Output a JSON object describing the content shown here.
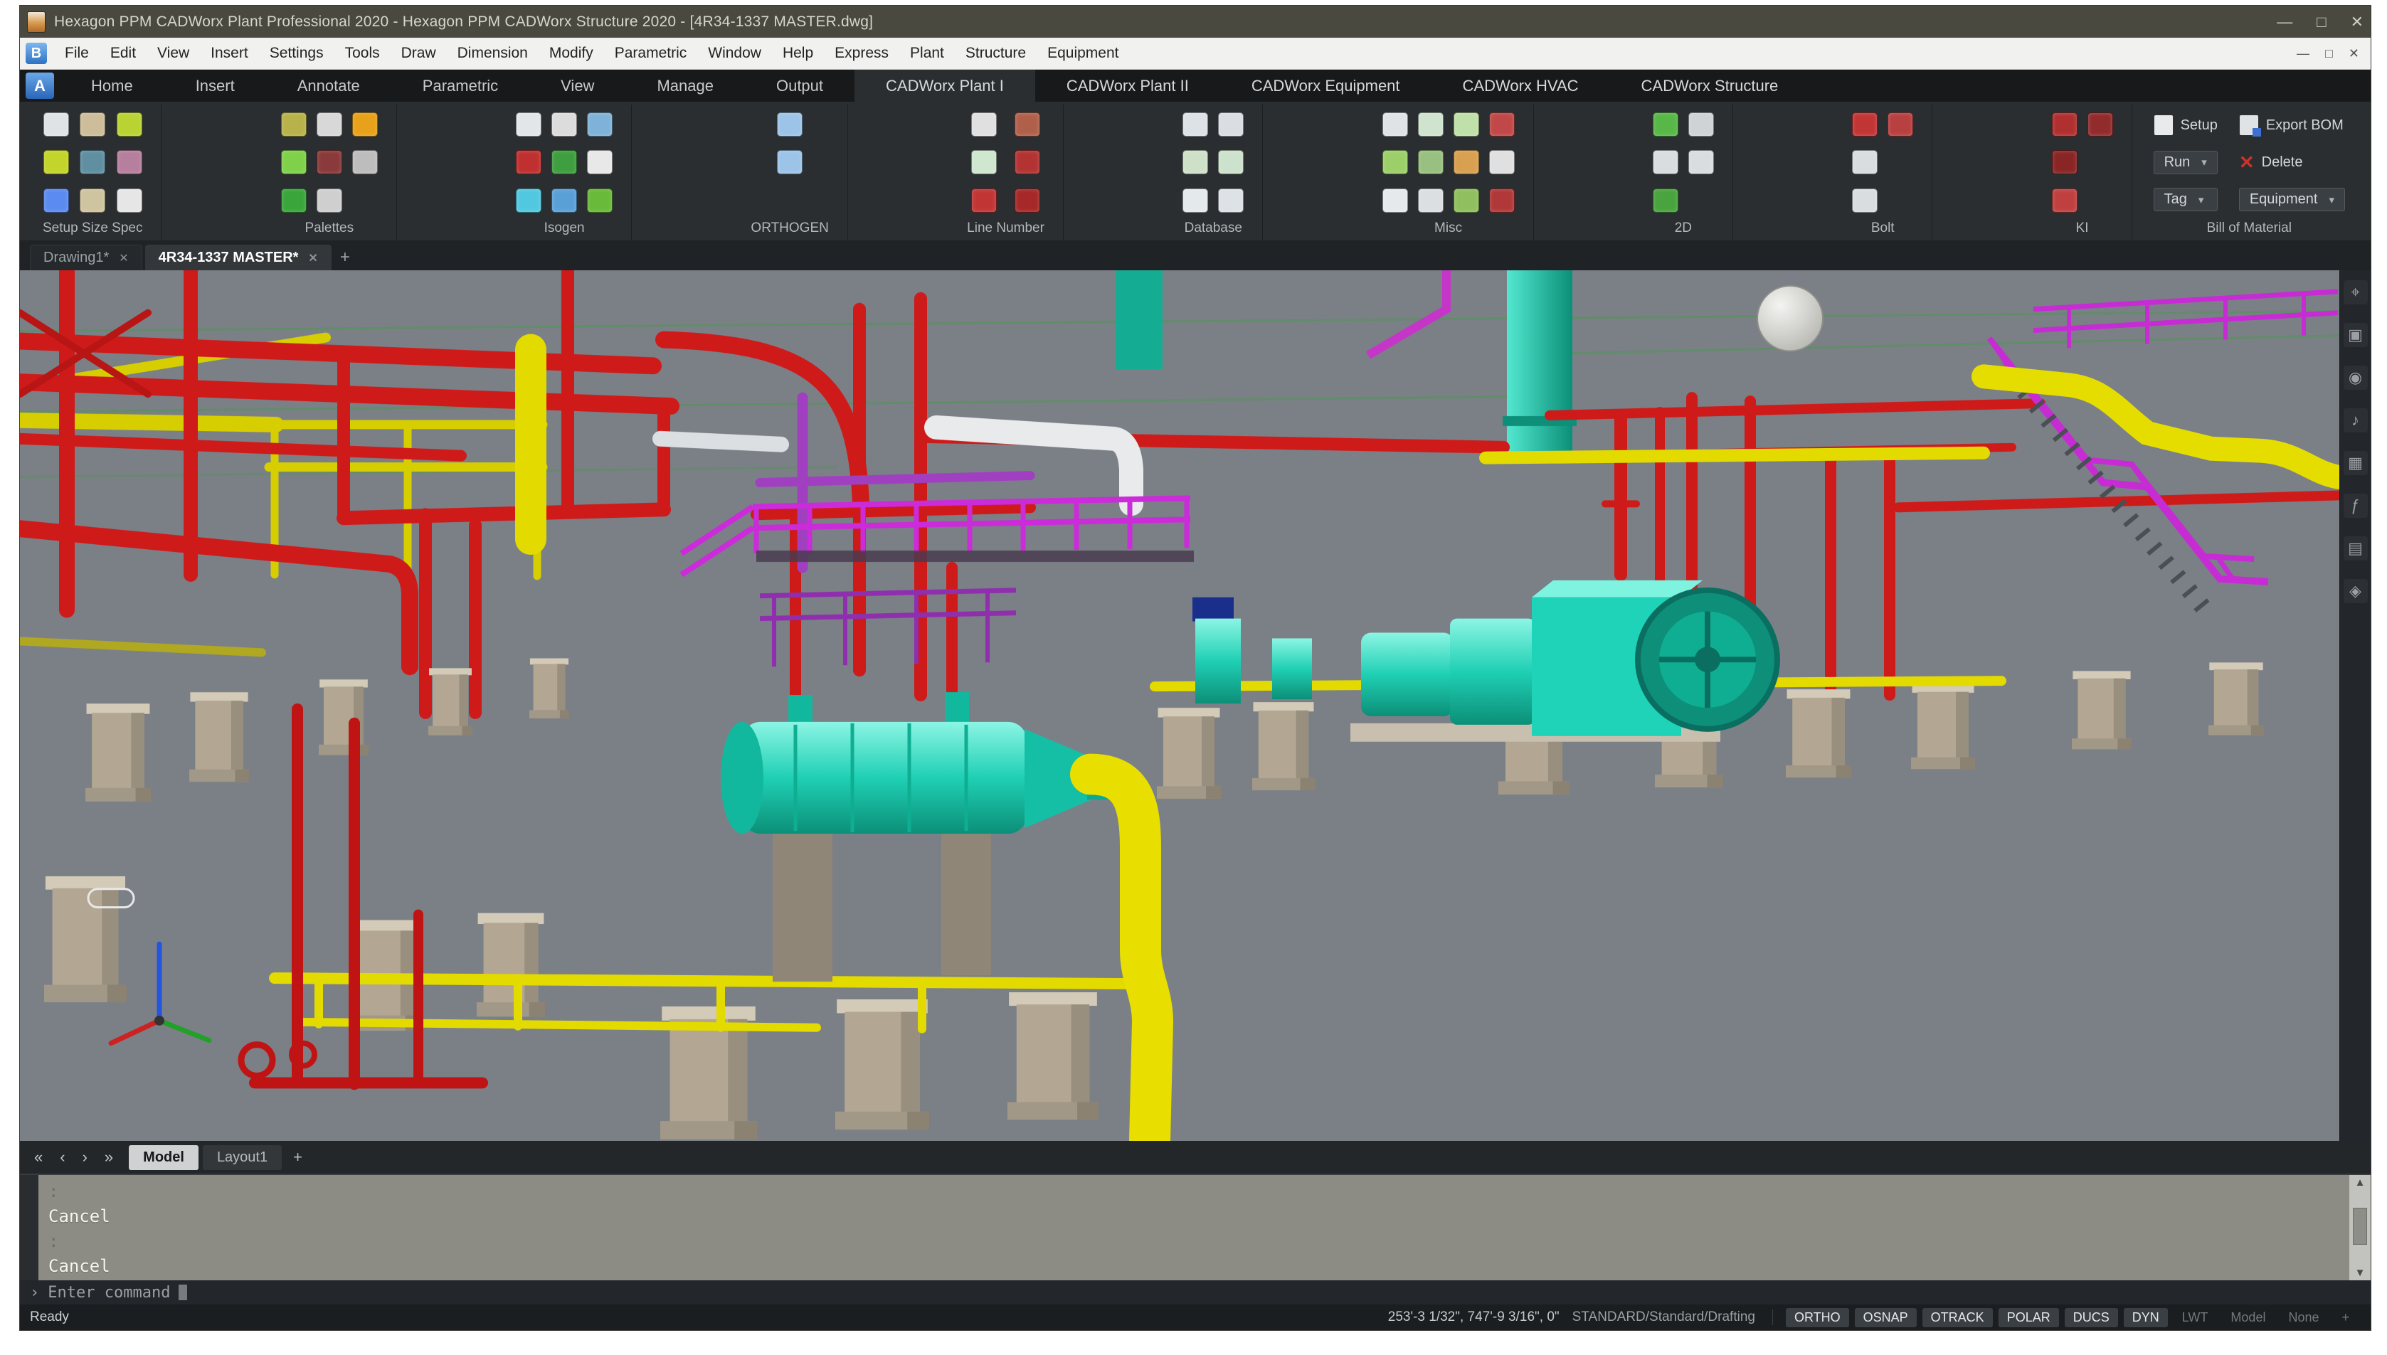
{
  "window": {
    "title": "Hexagon PPM CADWorx Plant Professional 2020 - Hexagon PPM CADWorx Structure 2020 - [4R34-1337 MASTER.dwg]",
    "controls": {
      "minimize": "—",
      "maximize": "□",
      "close": "✕"
    }
  },
  "menu": {
    "app_glyph": "B",
    "items": [
      "File",
      "Edit",
      "View",
      "Insert",
      "Settings",
      "Tools",
      "Draw",
      "Dimension",
      "Modify",
      "Parametric",
      "Window",
      "Help",
      "Express",
      "Plant",
      "Structure",
      "Equipment"
    ],
    "mdi_controls": [
      "—",
      "□",
      "✕"
    ]
  },
  "ribbon": {
    "app_glyph": "A",
    "tabs": [
      {
        "label": "Home",
        "active": false,
        "cadworx": false
      },
      {
        "label": "Insert",
        "active": false,
        "cadworx": false
      },
      {
        "label": "Annotate",
        "active": false,
        "cadworx": false
      },
      {
        "label": "Parametric",
        "active": false,
        "cadworx": false
      },
      {
        "label": "View",
        "active": false,
        "cadworx": false
      },
      {
        "label": "Manage",
        "active": false,
        "cadworx": false
      },
      {
        "label": "Output",
        "active": false,
        "cadworx": false
      },
      {
        "label": "CADWorx Plant I",
        "active": true,
        "cadworx": true
      },
      {
        "label": "CADWorx Plant II",
        "active": false,
        "cadworx": true
      },
      {
        "label": "CADWorx Equipment",
        "active": false,
        "cadworx": true
      },
      {
        "label": "CADWorx HVAC",
        "active": false,
        "cadworx": true
      },
      {
        "label": "CADWorx Structure",
        "active": false,
        "cadworx": true
      }
    ],
    "groups": [
      {
        "label": "Setup Size Spec",
        "icons": [
          {
            "n": "drawing-setup",
            "c": "#dfe3e6"
          },
          {
            "n": "size-palette",
            "c": "#c3d42b"
          },
          {
            "n": "navigate-blue",
            "c": "#5b8bf0"
          },
          {
            "n": "folder-spec",
            "c": "#cdbd9a"
          },
          {
            "n": "view-steel",
            "c": "#5f8fa0"
          },
          {
            "n": "spec-columns",
            "c": "#cfc4a0"
          },
          {
            "n": "size-select",
            "c": "#b9d332"
          },
          {
            "n": "spec-mauve",
            "c": "#b57f9d"
          },
          {
            "n": "grid-white",
            "c": "#e6e6e6"
          }
        ]
      },
      {
        "label": "Palettes",
        "icons": [
          {
            "n": "palette-olive",
            "c": "#b8b24a"
          },
          {
            "n": "palette-green",
            "c": "#7fd14a"
          },
          {
            "n": "refresh-green",
            "c": "#3aa53a"
          },
          {
            "n": "palette-plus",
            "c": "#d8d8d8"
          },
          {
            "n": "palette-red",
            "c": "#8a3a3a"
          },
          {
            "n": "palette-diamond",
            "c": "#cfcfcf"
          },
          {
            "n": "warning-triangle",
            "c": "#e8a11a"
          },
          {
            "n": "shield-gray",
            "c": "#bdbdbd"
          }
        ]
      },
      {
        "label": "Isogen",
        "icons": [
          {
            "n": "iso-doc",
            "c": "#e2e6e9"
          },
          {
            "n": "iso-stop",
            "c": "#c03030"
          },
          {
            "n": "iso-monitor-cyan",
            "c": "#52c8e0"
          },
          {
            "n": "iso-sheet",
            "c": "#dcdcdc"
          },
          {
            "n": "iso-tree",
            "c": "#3f9e3f"
          },
          {
            "n": "iso-monitor-blue",
            "c": "#5aa0d8"
          },
          {
            "n": "iso-grid",
            "c": "#7fb2d8"
          },
          {
            "n": "iso-circle",
            "c": "#e8e8e8"
          },
          {
            "n": "iso-plant",
            "c": "#69b93a"
          }
        ]
      },
      {
        "label": "ORTHOGEN",
        "icons": [
          {
            "n": "ortho-bolt-1",
            "c": "#9cc4e8"
          },
          {
            "n": "ortho-bolt-2",
            "c": "#9cc4e8"
          }
        ]
      },
      {
        "label": "Line Number",
        "icons": [
          {
            "n": "line-pump",
            "c": "#e0e0e0"
          },
          {
            "n": "line-diamond",
            "c": "#cfe6cf"
          },
          {
            "n": "line-red-1",
            "c": "#c23535"
          },
          {
            "n": "line-brown",
            "c": "#b0604a"
          },
          {
            "n": "line-red-2",
            "c": "#b33333"
          },
          {
            "n": "line-red-3",
            "c": "#a62828"
          }
        ]
      },
      {
        "label": "Database",
        "icons": [
          {
            "n": "db-export",
            "c": "#dde2e6"
          },
          {
            "n": "db-green-1",
            "c": "#cfe0c8"
          },
          {
            "n": "db-doc",
            "c": "#e4e9ec"
          },
          {
            "n": "db-sheet",
            "c": "#d8dee2"
          },
          {
            "n": "db-green-2",
            "c": "#cde2cc"
          },
          {
            "n": "db-table",
            "c": "#dce2e6"
          }
        ]
      },
      {
        "label": "Misc",
        "icons": [
          {
            "n": "misc-white-1",
            "c": "#dfe3e6"
          },
          {
            "n": "misc-green-1",
            "c": "#9ccf6a"
          },
          {
            "n": "misc-white-2",
            "c": "#e6e9ec"
          },
          {
            "n": "misc-green-2",
            "c": "#cfe3cf"
          },
          {
            "n": "misc-green-3",
            "c": "#98c080"
          },
          {
            "n": "misc-white-3",
            "c": "#dcdfe2"
          },
          {
            "n": "misc-green-4",
            "c": "#bfe0a8"
          },
          {
            "n": "misc-orange",
            "c": "#d8a050"
          },
          {
            "n": "misc-green-5",
            "c": "#8fbf5f"
          },
          {
            "n": "misc-red-1",
            "c": "#c04848"
          },
          {
            "n": "misc-white-4",
            "c": "#e0e0e0"
          },
          {
            "n": "misc-red-2",
            "c": "#b03838"
          }
        ]
      },
      {
        "label": "2D",
        "icons": [
          {
            "n": "2d-green-1",
            "c": "#58b847"
          },
          {
            "n": "2d-white-1",
            "c": "#d9dde0"
          },
          {
            "n": "2d-green-2",
            "c": "#49a33e"
          },
          {
            "n": "2d-white-2",
            "c": "#cfd3d6"
          },
          {
            "n": "2d-white-3",
            "c": "#d9dde0"
          }
        ]
      },
      {
        "label": "Bolt",
        "icons": [
          {
            "n": "bolt-red",
            "c": "#c23535"
          },
          {
            "n": "bolt-white-1",
            "c": "#d9dde0"
          },
          {
            "n": "bolt-white-2",
            "c": "#d9dde0"
          },
          {
            "n": "bolt-dark-red",
            "c": "#b84040"
          }
        ]
      },
      {
        "label": "KI",
        "icons": [
          {
            "n": "ki-red-1",
            "c": "#b03030"
          },
          {
            "n": "ki-dark-1",
            "c": "#8a2525"
          },
          {
            "n": "ki-red-2",
            "c": "#c04040"
          },
          {
            "n": "ki-dark-2",
            "c": "#922c2c"
          }
        ]
      }
    ],
    "bom": {
      "label": "Bill of Material",
      "setup": "Setup",
      "export_bom": "Export BOM",
      "run": "Run",
      "delete": "Delete",
      "tag": "Tag",
      "equipment": "Equipment",
      "dropdown_arrow": "▾",
      "delete_glyph": "✕"
    }
  },
  "document_tabs": {
    "tabs": [
      {
        "label": "Drawing1*",
        "close": "✕",
        "active": false
      },
      {
        "label": "4R34-1337 MASTER*",
        "close": "✕",
        "active": true
      }
    ],
    "add": "+"
  },
  "viewport": {
    "palette": {
      "background": "#7b8087",
      "pipe_red": "#d01818",
      "pipe_yellow": "#e6dd00",
      "equipment_cyan": "#1ed3b8",
      "rail_magenta": "#cb2bd8",
      "concrete": "#b3a793",
      "structure_green": "#5d8f63",
      "pipe_white": "#e8eaec",
      "ucs_x": "#cc2222",
      "ucs_y": "#22a02a",
      "ucs_z": "#2255e0"
    }
  },
  "side_toolbar": {
    "icons": [
      {
        "name": "target-icon",
        "glyph": "⌖"
      },
      {
        "name": "monitor-icon",
        "glyph": "▣"
      },
      {
        "name": "camera-icon",
        "glyph": "◉"
      },
      {
        "name": "sound-icon",
        "glyph": "♪"
      },
      {
        "name": "grid-icon",
        "glyph": "▦"
      },
      {
        "name": "function-icon",
        "glyph": "ƒ"
      },
      {
        "name": "sheet-icon",
        "glyph": "▤"
      },
      {
        "name": "diamond-icon",
        "glyph": "◈"
      }
    ]
  },
  "layout_bar": {
    "nav": [
      "«",
      "‹",
      "›",
      "»"
    ],
    "tabs": [
      {
        "label": "Model",
        "active": true
      },
      {
        "label": "Layout1",
        "active": false
      }
    ],
    "add": "+"
  },
  "command": {
    "lines": [
      ":",
      "Cancel",
      ":",
      "Cancel"
    ],
    "prompt_symbol": "›",
    "prompt": "Enter command",
    "scroll_up": "▲",
    "scroll_down": "▼"
  },
  "status": {
    "left": "Ready",
    "coords": "253'-3 1/32\", 747'-9 3/16\", 0\"",
    "space": "STANDARD/Standard/Drafting",
    "toggles": [
      {
        "label": "ORTHO",
        "active": true
      },
      {
        "label": "OSNAP",
        "active": true
      },
      {
        "label": "OTRACK",
        "active": true
      },
      {
        "label": "POLAR",
        "active": true
      },
      {
        "label": "DUCS",
        "active": true
      },
      {
        "label": "DYN",
        "active": true
      },
      {
        "label": "LWT",
        "active": false
      },
      {
        "label": "Model",
        "active": false
      },
      {
        "label": "None",
        "active": false
      },
      {
        "label": "+",
        "active": false
      }
    ]
  }
}
